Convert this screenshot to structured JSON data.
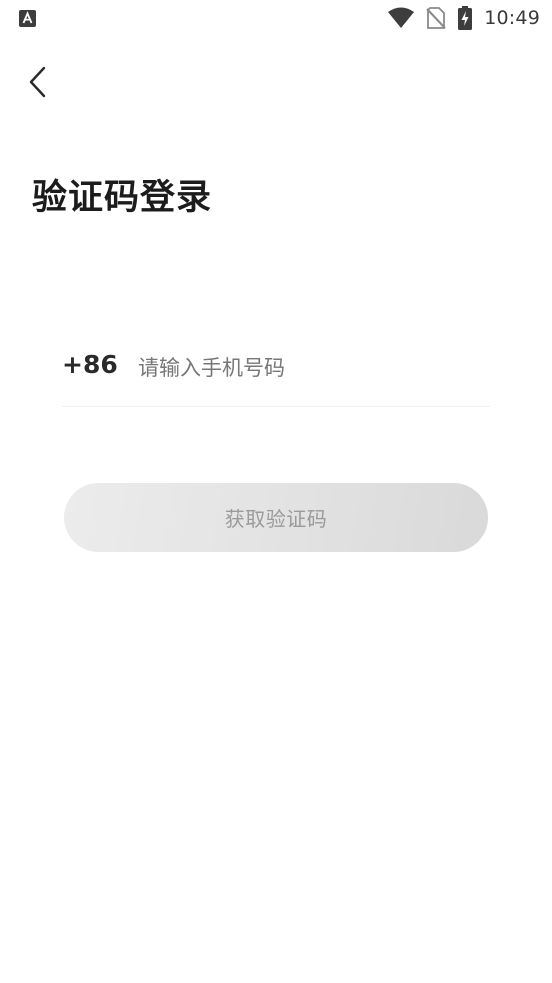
{
  "status_bar": {
    "time": "10:49",
    "icons": [
      "app-notification-icon",
      "wifi-icon",
      "no-sim-icon",
      "battery-charging-icon"
    ]
  },
  "nav": {
    "back_icon": "chevron-left-icon"
  },
  "title": "验证码登录",
  "phone": {
    "country_code": "+86",
    "placeholder": "请输入手机号码",
    "value": ""
  },
  "get_code_button": {
    "label": "获取验证码"
  },
  "colors": {
    "title": "#1c1c1c",
    "placeholder": "#777777",
    "button_bg": "#e2e2e2",
    "button_text": "#9a9a9a",
    "divider": "#efefef"
  }
}
